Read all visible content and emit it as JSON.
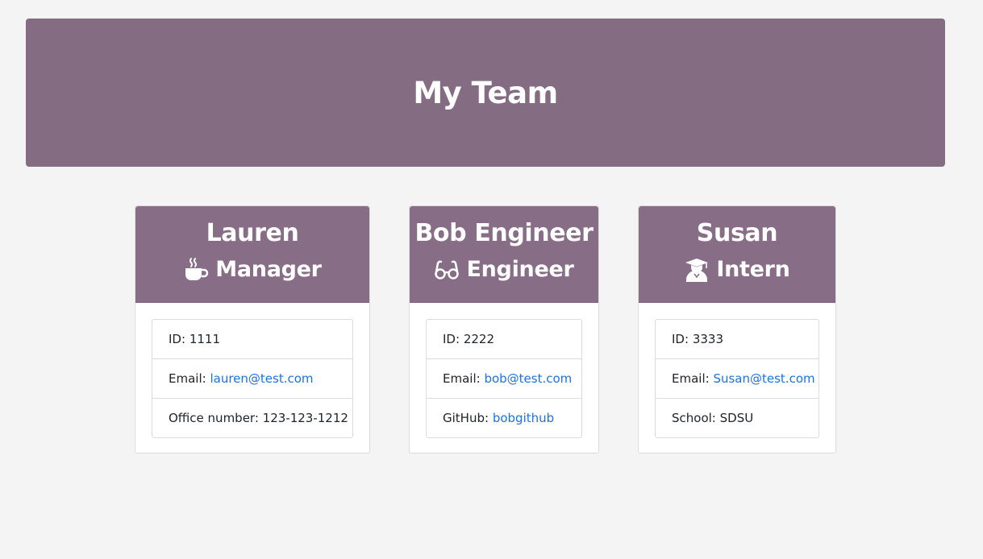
{
  "header": {
    "title": "My Team"
  },
  "team": [
    {
      "name": "Lauren",
      "role": "Manager",
      "icon": "coffee-mug-icon",
      "id_label": "ID:",
      "id_value": "1111",
      "email_label": "Email:",
      "email_value": "lauren@test.com",
      "extra_label": "Office number:",
      "extra_value": "123-123-1212"
    },
    {
      "name": "Bob Engineer",
      "role": "Engineer",
      "icon": "glasses-icon",
      "id_label": "ID:",
      "id_value": "2222",
      "email_label": "Email:",
      "email_value": "bob@test.com",
      "extra_label": "GitHub:",
      "extra_value": "bobgithub"
    },
    {
      "name": "Susan",
      "role": "Intern",
      "icon": "graduate-icon",
      "id_label": "ID:",
      "id_value": "3333",
      "email_label": "Email:",
      "email_value": "Susan@test.com",
      "extra_label": "School:",
      "extra_value": "SDSU"
    }
  ],
  "colors": {
    "header_bg": "#846c82",
    "card_header_bg": "#876d86",
    "link": "#1a73e8",
    "page_bg": "#f4f4f4"
  }
}
